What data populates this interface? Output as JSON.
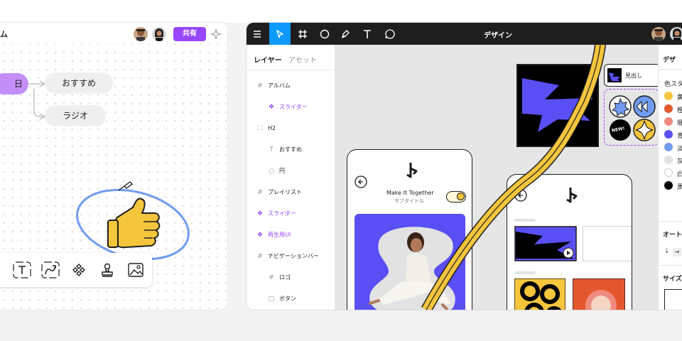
{
  "whiteboard": {
    "title_fragment": "ム",
    "share_label": "共有",
    "nodes": {
      "today": "日",
      "recommended": "おすすめ",
      "radio": "ラジオ"
    },
    "tools": [
      "text-tool-icon",
      "connector-tool-icon",
      "component-tool-icon",
      "stamp-tool-icon",
      "image-tool-icon"
    ]
  },
  "design": {
    "title": "デザイン",
    "tools": [
      "menu-icon",
      "move-icon",
      "frame-icon",
      "ellipse-icon",
      "pen-icon",
      "text-icon",
      "comment-icon"
    ],
    "layers_tab": "レイヤー",
    "assets_tab": "アセット",
    "layers": [
      {
        "label": "アルバム",
        "icon": "#",
        "kind": "frame"
      },
      {
        "label": "スライダー",
        "icon": "❖",
        "kind": "component"
      },
      {
        "label": "H2",
        "icon": "⬚",
        "kind": "group"
      },
      {
        "label": "おすすめ",
        "icon": "T",
        "kind": "text"
      },
      {
        "label": "円",
        "icon": "○",
        "kind": "ellipse"
      },
      {
        "label": "プレイリスト",
        "icon": "#",
        "kind": "frame"
      },
      {
        "label": "スライダー",
        "icon": "❖",
        "kind": "component"
      },
      {
        "label": "再生用UI",
        "icon": "❖",
        "kind": "component"
      },
      {
        "label": "ナビゲーションバー",
        "icon": "#",
        "kind": "frame"
      },
      {
        "label": "ロゴ",
        "icon": "#",
        "kind": "frame"
      },
      {
        "label": "ボタン",
        "icon": "□",
        "kind": "rect"
      }
    ],
    "canvas": {
      "heading_chip": "見出し",
      "player_title": "Make It Together",
      "player_subtitle": "サブタイトル",
      "badge_new": "NEW!"
    },
    "right_panel": {
      "header": "デザ",
      "color_styles_label": "色スタ",
      "colors": [
        {
          "hex": "#f5c53c",
          "label": "黄"
        },
        {
          "hex": "#e4572e",
          "label": "橙"
        },
        {
          "hex": "#f08a7e",
          "label": "珊"
        },
        {
          "hex": "#5a4ff5",
          "label": "青"
        },
        {
          "hex": "#6f9cf2",
          "label": "淡"
        },
        {
          "hex": "#e2e2e2",
          "label": "灰"
        },
        {
          "hex": "#ffffff",
          "label": "白"
        },
        {
          "hex": "#000000",
          "label": "黒"
        }
      ],
      "auto_layout_label": "オート",
      "size_label": "サイズ"
    }
  },
  "colors": {
    "accent_purple": "#9747ff",
    "accent_blue": "#0d99ff",
    "yellow": "#f5c53c",
    "indigo": "#5a4ff5"
  }
}
